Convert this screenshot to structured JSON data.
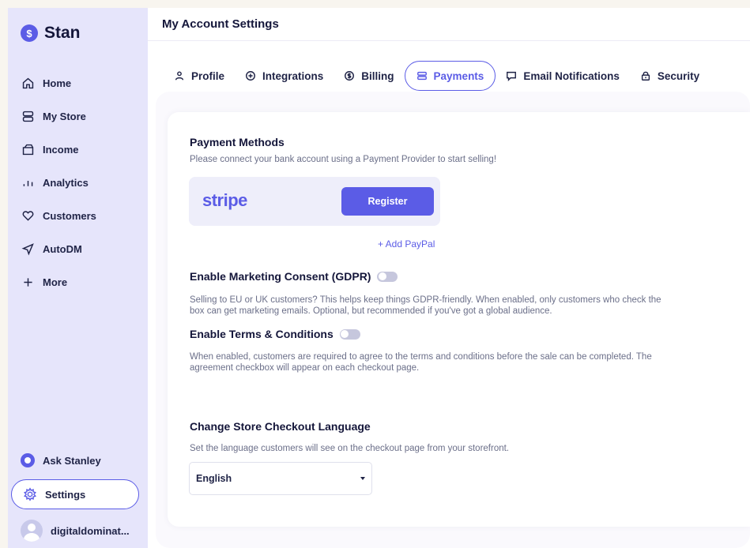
{
  "app": {
    "name": "Stan",
    "logo_glyph": "$"
  },
  "sidebar": {
    "items": [
      {
        "label": "Home",
        "icon": "home-icon"
      },
      {
        "label": "My Store",
        "icon": "store-icon"
      },
      {
        "label": "Income",
        "icon": "wallet-icon"
      },
      {
        "label": "Analytics",
        "icon": "bar-chart-icon"
      },
      {
        "label": "Customers",
        "icon": "heart-icon"
      },
      {
        "label": "AutoDM",
        "icon": "send-icon"
      },
      {
        "label": "More",
        "icon": "plus-icon"
      }
    ],
    "ask_label": "Ask Stanley",
    "settings_label": "Settings",
    "user_name": "digitaldominat..."
  },
  "header": {
    "title": "My Account Settings"
  },
  "tabs": [
    {
      "label": "Profile",
      "icon": "user-icon",
      "active": false
    },
    {
      "label": "Integrations",
      "icon": "plus-circle-icon",
      "active": false
    },
    {
      "label": "Billing",
      "icon": "dollar-circle-icon",
      "active": false
    },
    {
      "label": "Payments",
      "icon": "card-icon",
      "active": true
    },
    {
      "label": "Email Notifications",
      "icon": "message-icon",
      "active": false
    },
    {
      "label": "Security",
      "icon": "lock-icon",
      "active": false
    }
  ],
  "payments": {
    "methods_title": "Payment Methods",
    "methods_desc": "Please connect your bank account using a Payment Provider to start selling!",
    "stripe_logo": "stripe",
    "register_label": "Register",
    "add_paypal_label": "+ Add PayPal",
    "gdpr_title": "Enable Marketing Consent (GDPR)",
    "gdpr_enabled": false,
    "gdpr_desc_1": "Selling to EU or UK customers? This helps keep things GDPR-friendly. When enabled, only customers who check the",
    "gdpr_desc_2": "box can get marketing emails. Optional, but recommended if you've got a global audience.",
    "terms_title": "Enable Terms & Conditions",
    "terms_enabled": false,
    "terms_desc_1": "When enabled, customers are required to agree to the terms and conditions before the sale can be completed. The",
    "terms_desc_2": "agreement checkbox will appear on each checkout page.",
    "language_title": "Change Store Checkout Language",
    "language_desc": "Set the language customers will see on the checkout page from your storefront.",
    "language_value": "English"
  },
  "colors": {
    "accent": "#5b5ce6",
    "sidebar_bg": "#e6e5fb",
    "text": "#1f2346"
  }
}
